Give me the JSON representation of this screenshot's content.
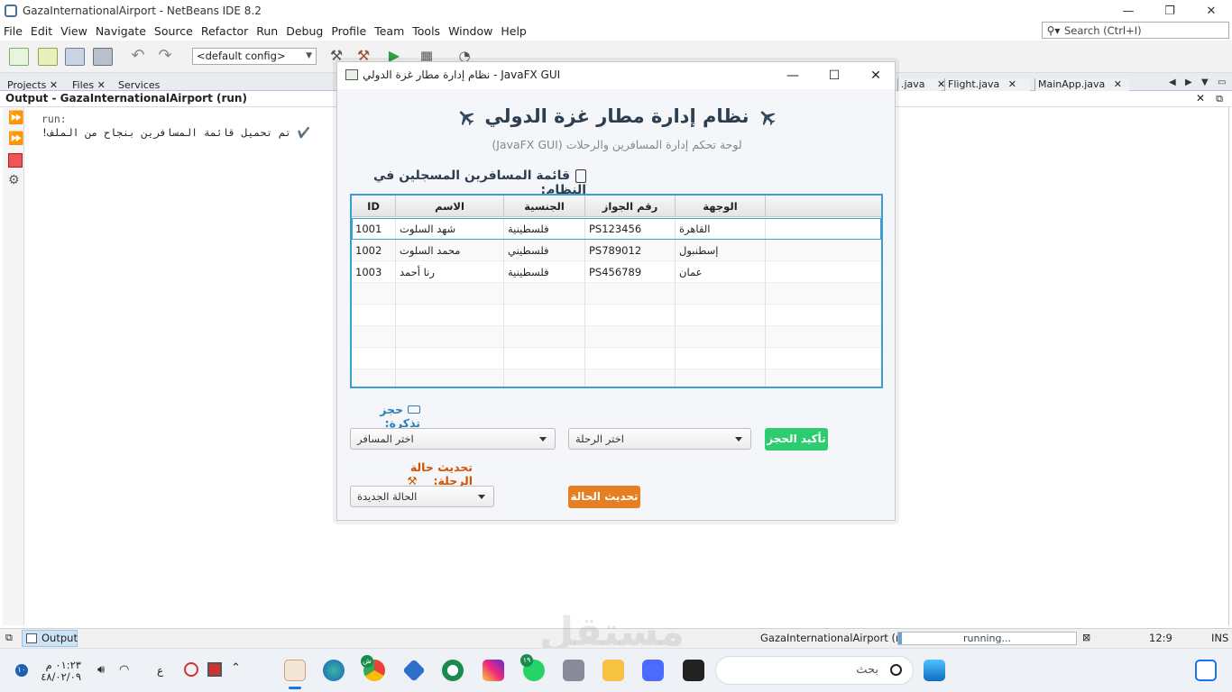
{
  "ide": {
    "window_title": "GazaInternationalAirport - NetBeans IDE 8.2",
    "menu": [
      "File",
      "Edit",
      "View",
      "Navigate",
      "Source",
      "Refactor",
      "Run",
      "Debug",
      "Profile",
      "Team",
      "Tools",
      "Window",
      "Help"
    ],
    "search_placeholder": "Search (Ctrl+I)",
    "config": "<default config>",
    "panel_tabs": [
      "Projects",
      "Files",
      "Services"
    ],
    "editor_tabs": [
      ".java",
      "Flight.java",
      "MainApp.java"
    ],
    "output_title": "Output - GazaInternationalAirport (run)",
    "output_lines": [
      "run:",
      "✔️ تم تحميل قائمة المسافرين بنجاح من الملف!"
    ],
    "status": {
      "output_tab": "Output",
      "run_label": "GazaInternationalAirport (run)",
      "progress_text": "running...",
      "caret": "12:9",
      "mode": "INS"
    }
  },
  "fx": {
    "window_title": "نظام إدارة مطار غزة الدولي - JavaFX GUI",
    "app_title": "نظام إدارة مطار غزة الدولي",
    "subtitle": "لوحة تحكم إدارة المسافرين والرحلات (JavaFX GUI)",
    "list_header": "قائمة المسافرين المسجلين في النظام:",
    "table": {
      "columns": [
        "ID",
        "الاسم",
        "الجنسية",
        "رقم الجواز",
        "الوجهة",
        ""
      ],
      "rows": [
        [
          "1001",
          "شهد السلوت",
          "فلسطينية",
          "PS123456",
          "القاهرة",
          ""
        ],
        [
          "1002",
          "محمد السلوت",
          "فلسطيني",
          "PS789012",
          "إسطنبول",
          ""
        ],
        [
          "1003",
          "رنا أحمد",
          "فلسطينية",
          "PS456789",
          "عمان",
          ""
        ]
      ]
    },
    "booking_label": "حجز تذكرة:",
    "passenger_combo": "اختر المسافر",
    "flight_combo": "اختر الرحلة",
    "confirm_button": "تأكيد الحجز",
    "status_label": "تحديث حالة الرحلة:",
    "status_combo": "الحالة الجديدة",
    "update_button": "تحديث الحالة",
    "colors": {
      "green": "#2ecc71",
      "orange": "#e67e22",
      "title": "#2c3e50",
      "accent": "#3a9fcf"
    }
  },
  "taskbar": {
    "time": "٠١:٢٣ م",
    "date": "٤٨/٠٢/٠٩",
    "lang": "ع",
    "search_placeholder": "بحث",
    "badge_chrome": "ش",
    "badge_whatsapp": "١٩"
  },
  "watermark": "مستقل"
}
